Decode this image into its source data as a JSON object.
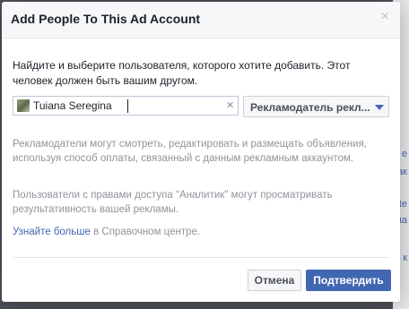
{
  "dialog": {
    "title": "Add People To This Ad Account",
    "close_symbol": "×",
    "description": "Найдите и выберите пользователя, которого хотите добавить. Этот человек должен быть вашим другом.",
    "person_input": {
      "value": "Tuiana Seregina",
      "clear_symbol": "×"
    },
    "role_select": {
      "selected": "Рекламодатель рекл..."
    },
    "info_advertiser": "Рекламодатели могут смотреть, редактировать и размещать объявления, используя способ оплаты, связанный с данным рекламным аккаунтом.",
    "info_analyst": "Пользователи с правами доступа \"Аналитик\" могут просматривать результативность вашей рекламы.",
    "learn_more": {
      "link": "Узнайте больше",
      "suffix": " в Справочном центре."
    },
    "buttons": {
      "cancel": "Отмена",
      "confirm": "Подтвердить"
    }
  },
  "background_fragments": [
    "е",
    "ак",
    "te",
    "ла",
    "к"
  ],
  "icons": {
    "close": "close-icon",
    "clear": "clear-icon",
    "avatar": "user-avatar",
    "dropdown": "chevron-down-icon"
  },
  "colors": {
    "accent": "#4267b2",
    "muted_text": "#90949c",
    "header_bg": "#f6f7f9"
  }
}
